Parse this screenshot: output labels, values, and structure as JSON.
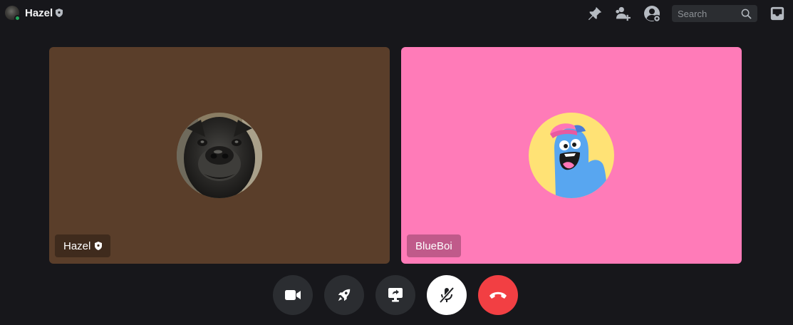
{
  "header": {
    "user_name": "Hazel",
    "search_placeholder": "Search"
  },
  "icons": {
    "pin": "pin-icon",
    "add_friends": "add-friends-icon",
    "user_profile": "user-profile-icon",
    "search": "search-icon",
    "inbox": "inbox-icon",
    "shield": "shield-icon"
  },
  "participants": [
    {
      "name": "Hazel",
      "tile_color": "#5a3e2a",
      "tag_bg": "#3f2b1d",
      "verified": true
    },
    {
      "name": "BlueBoi",
      "tile_color": "#ff7bb8",
      "tag_bg": "#c05a8a",
      "verified": false
    }
  ],
  "controls": [
    {
      "name": "camera",
      "icon": "video-camera-icon"
    },
    {
      "name": "activities",
      "icon": "rocket-icon"
    },
    {
      "name": "share-screen",
      "icon": "screen-share-icon"
    },
    {
      "name": "mute",
      "icon": "microphone-muted-icon",
      "state": "muted"
    },
    {
      "name": "disconnect",
      "icon": "hang-up-icon"
    }
  ],
  "colors": {
    "background": "#17171b",
    "online": "#23a559",
    "danger": "#f23f43"
  }
}
